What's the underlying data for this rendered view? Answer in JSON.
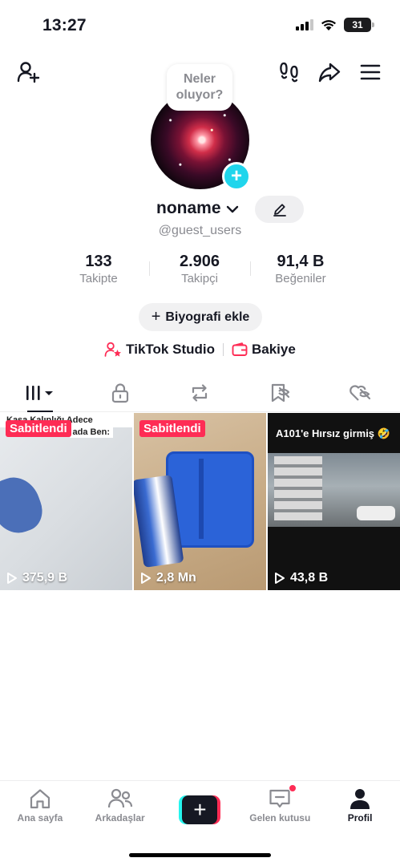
{
  "status_bar": {
    "time": "13:27",
    "battery": "31"
  },
  "top_nav": {
    "add_friend_icon": "person-plus-icon",
    "footprints_icon": "footprints-icon",
    "share_icon": "share-arrow-icon",
    "menu_icon": "hamburger-menu-icon"
  },
  "profile": {
    "bubble_text_line1": "Neler",
    "bubble_text_line2": "oluyor?",
    "username": "noname",
    "handle": "@guest_users"
  },
  "stats": [
    {
      "value": "133",
      "label": "Takipte"
    },
    {
      "value": "2.906",
      "label": "Takipçi"
    },
    {
      "value": "91,4 B",
      "label": "Beğeniler"
    }
  ],
  "bio_button": {
    "plus": "+",
    "label": "Biyografi ekle"
  },
  "links": {
    "studio": "TikTok Studio",
    "balance": "Bakiye"
  },
  "tabs": [
    "videos-grid",
    "private-lock",
    "reposts",
    "favorites",
    "liked"
  ],
  "videos": [
    {
      "pinned": "Sabitlendi",
      "views": "375,9 B",
      "overlay_top": "Kasa Kalınlığı Adece",
      "overlay_sub": "ada Ben:"
    },
    {
      "pinned": "Sabitlendi",
      "views": "2,8 Mn"
    },
    {
      "title": "A101'e Hırsız girmiş 🤣",
      "views": "43,8 B"
    }
  ],
  "bottom_nav": [
    {
      "label": "Ana sayfa"
    },
    {
      "label": "Arkadaşlar"
    },
    {
      "label": ""
    },
    {
      "label": "Gelen kutusu"
    },
    {
      "label": "Profil"
    }
  ],
  "colors": {
    "accent_red": "#fe2c55",
    "accent_cyan": "#20d5ec",
    "text": "#161823",
    "muted": "#8a8b91"
  }
}
